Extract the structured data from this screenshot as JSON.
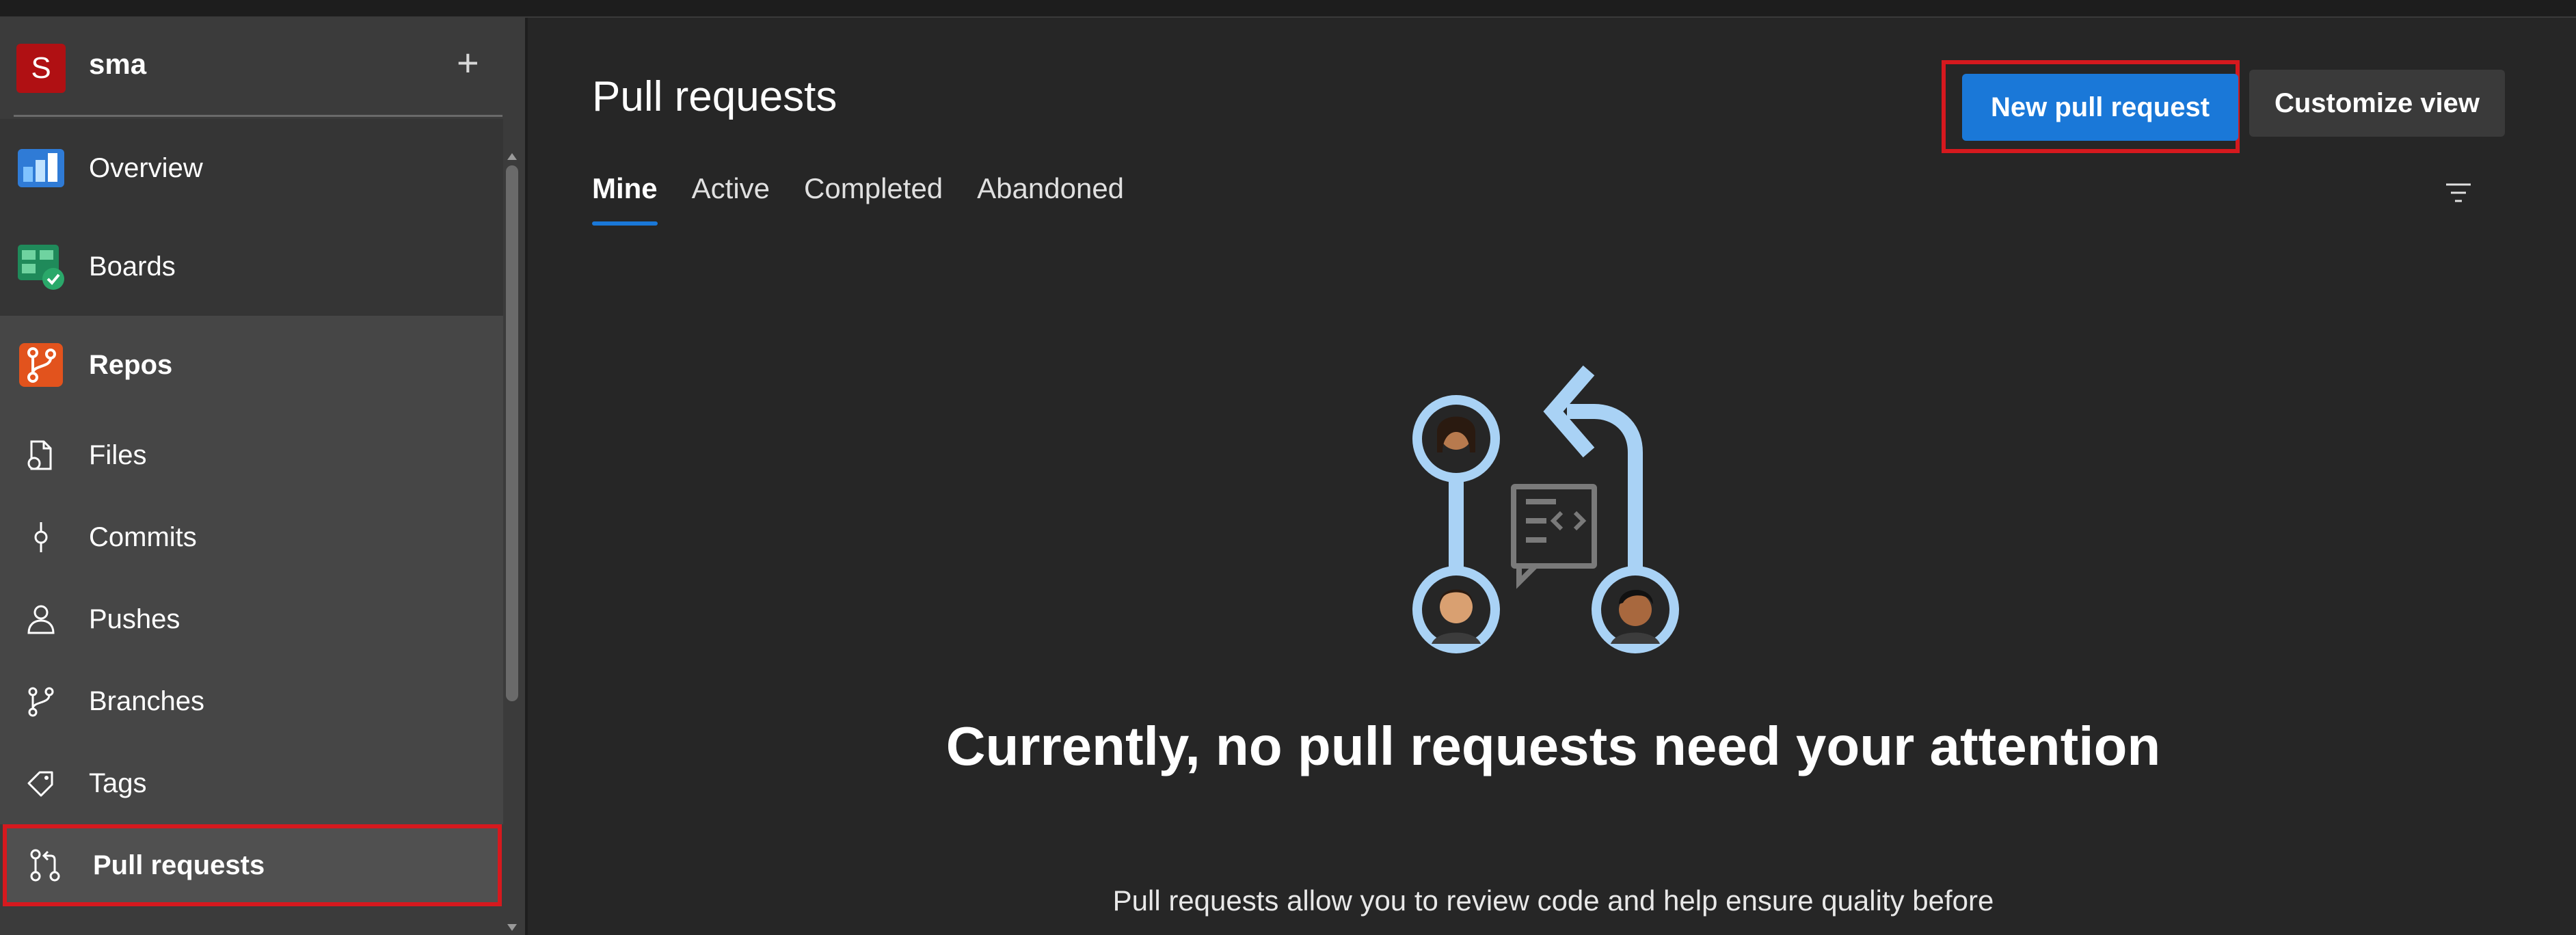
{
  "project": {
    "avatar_letter": "S",
    "name": "sma",
    "add_label": "+"
  },
  "nav": {
    "items": [
      {
        "label": "Overview",
        "icon": "overview-icon"
      },
      {
        "label": "Boards",
        "icon": "boards-icon"
      },
      {
        "label": "Repos",
        "icon": "repos-icon"
      },
      {
        "label": "Files",
        "icon": "files-icon"
      },
      {
        "label": "Commits",
        "icon": "commits-icon"
      },
      {
        "label": "Pushes",
        "icon": "pushes-icon"
      },
      {
        "label": "Branches",
        "icon": "branches-icon"
      },
      {
        "label": "Tags",
        "icon": "tags-icon"
      },
      {
        "label": "Pull requests",
        "icon": "pull-requests-icon"
      }
    ]
  },
  "header": {
    "title": "Pull requests",
    "new_pr_label": "New pull request",
    "customize_label": "Customize view"
  },
  "tabs": [
    "Mine",
    "Active",
    "Completed",
    "Abandoned"
  ],
  "empty_state": {
    "title": "Currently, no pull requests need your attention",
    "description": "Pull requests allow you to review code and help ensure quality before"
  },
  "colors": {
    "accent": "#1a78d8",
    "highlight": "#d6191e",
    "avatar": "#b01013"
  }
}
